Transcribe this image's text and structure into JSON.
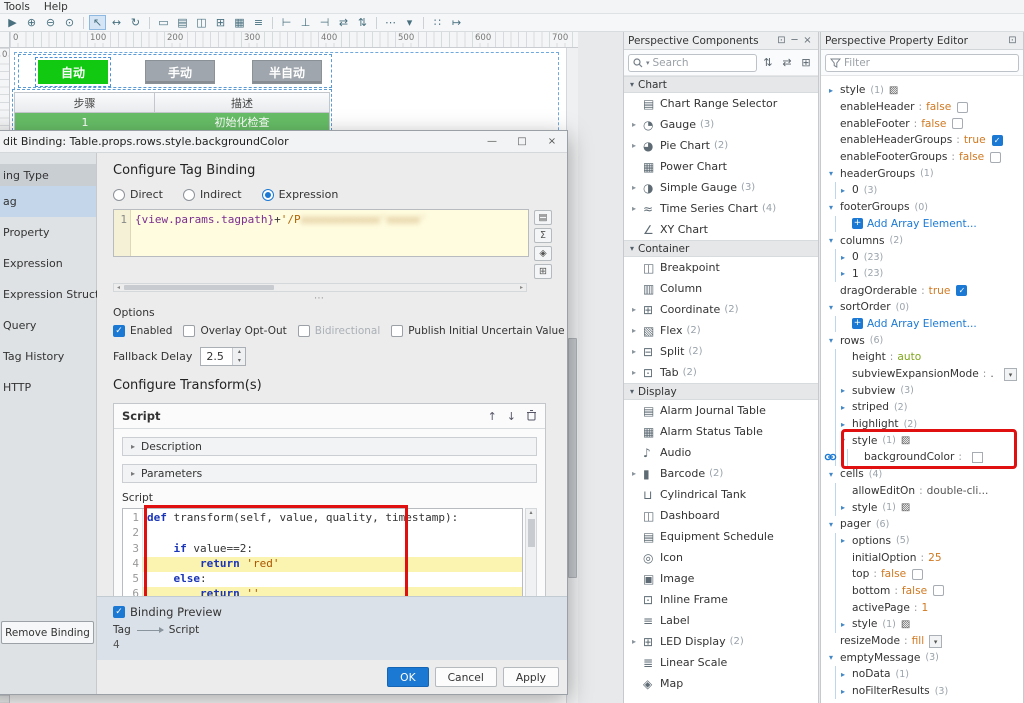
{
  "menubar": {
    "items": [
      {
        "label": "Tools"
      },
      {
        "label": "Help"
      }
    ]
  },
  "toolbar": {
    "icons": [
      {
        "name": "play-icon",
        "glyph": "▶"
      },
      {
        "name": "zoom-in-icon",
        "glyph": "⊕"
      },
      {
        "name": "zoom-out-icon",
        "glyph": "⊖"
      },
      {
        "name": "zoom-actual-icon",
        "glyph": "⊙"
      },
      {
        "sep": true
      },
      {
        "name": "select-tool-icon",
        "glyph": "↖",
        "active": true
      },
      {
        "name": "pan-tool-icon",
        "glyph": "↔"
      },
      {
        "name": "rotate-tool-icon",
        "glyph": "↻"
      },
      {
        "sep": true
      },
      {
        "name": "rectangle-tool-icon",
        "glyph": "▭"
      },
      {
        "name": "browser-preview-icon",
        "glyph": "▤"
      },
      {
        "name": "split-view-icon",
        "glyph": "◫"
      },
      {
        "name": "grid-icon",
        "glyph": "⊞"
      },
      {
        "name": "table-icon",
        "glyph": "▦"
      },
      {
        "name": "text-icon",
        "glyph": "≡"
      },
      {
        "sep": true
      },
      {
        "name": "align-left-icon",
        "glyph": "⊢"
      },
      {
        "name": "align-center-icon",
        "glyph": "⊥"
      },
      {
        "name": "align-right-icon",
        "glyph": "⊣"
      },
      {
        "name": "distribute-horizontal-icon",
        "glyph": "⇄"
      },
      {
        "name": "distribute-vertical-icon",
        "glyph": "⇅"
      },
      {
        "sep": true
      },
      {
        "name": "more-options-icon",
        "glyph": "⋯"
      },
      {
        "name": "dropdown-icon",
        "glyph": "▾"
      },
      {
        "sep": true
      },
      {
        "name": "snap-icon",
        "glyph": "∷"
      },
      {
        "name": "measure-icon",
        "glyph": "↦"
      }
    ]
  },
  "rulers": {
    "horizontal": [
      "0",
      "100",
      "200",
      "300",
      "400",
      "500",
      "600",
      "700"
    ],
    "vertical": [
      "0"
    ]
  },
  "canvas": {
    "buttons": [
      {
        "name": "auto",
        "label": "自动",
        "variant": "green",
        "selected": true
      },
      {
        "name": "manual",
        "label": "手动",
        "variant": "gray",
        "selected": false
      },
      {
        "name": "semi-auto",
        "label": "半自动",
        "variant": "gray",
        "selected": false
      }
    ],
    "table": {
      "headers": [
        "步骤",
        "描述"
      ],
      "rows": [
        [
          "1",
          "初始化检查"
        ]
      ]
    }
  },
  "binding_dialog": {
    "title": "dit Binding: Table.props.rows.style.backgroundColor",
    "sidebar": {
      "header": "ing Type",
      "items": [
        {
          "label": "ag",
          "name": "sidebar-item-tag",
          "selected": true
        },
        {
          "label": "Property",
          "name": "sidebar-item-property",
          "selected": false
        },
        {
          "label": "Expression",
          "name": "sidebar-item-expression",
          "selected": false
        },
        {
          "label": "Expression Structure",
          "name": "sidebar-item-expression-structure",
          "selected": false
        },
        {
          "label": "Query",
          "name": "sidebar-item-query",
          "selected": false
        },
        {
          "label": "Tag History",
          "name": "sidebar-item-tag-history",
          "selected": false
        },
        {
          "label": "HTTP",
          "name": "sidebar-item-http",
          "selected": false
        }
      ],
      "remove_button": "Remove Binding"
    },
    "config": {
      "heading": "Configure Tag Binding",
      "modes": [
        {
          "label": "Direct",
          "selected": false
        },
        {
          "label": "Indirect",
          "selected": false
        },
        {
          "label": "Expression",
          "selected": true
        }
      ],
      "expression": {
        "line": "1",
        "reference": "{view.params.tagpath}",
        "operator": "+",
        "string_start": "'/P",
        "redacted": "xxxxxxxxxxxx'xxxxx'"
      },
      "expression_tools": [
        {
          "name": "browse-tags-icon",
          "glyph": "▤"
        },
        {
          "name": "functions-icon",
          "glyph": "Σ"
        },
        {
          "name": "tag-icon",
          "glyph": "◈"
        },
        {
          "name": "operators-icon",
          "glyph": "⊞"
        }
      ],
      "options_label": "Options",
      "checkboxes": [
        {
          "label": "Enabled",
          "checked": true,
          "disabled": false
        },
        {
          "label": "Overlay Opt-Out",
          "checked": false,
          "disabled": false
        },
        {
          "label": "Bidirectional",
          "checked": false,
          "disabled": true
        },
        {
          "label": "Publish Initial Uncertain Value",
          "checked": false,
          "disabled": false
        }
      ],
      "fallback_delay_label": "Fallback Delay",
      "fallback_delay_value": "2.5"
    },
    "transforms": {
      "heading": "Configure Transform(s)",
      "panel_title": "Script",
      "collapsed_sections": [
        "Description",
        "Parameters"
      ],
      "script_label": "Script",
      "code_lines": [
        "def transform(self, value, quality, timestamp):",
        "",
        "    if value==2:",
        "        return 'red'",
        "    else:",
        "        return ''"
      ],
      "highlighted_lines": [
        4,
        6
      ]
    },
    "preview": {
      "checkbox_label": "Binding Preview",
      "checked": true,
      "source_label": "Tag",
      "source_value": "4",
      "target_label": "Script"
    },
    "buttons": [
      {
        "label": "OK",
        "variant": "primary",
        "name": "ok-button"
      },
      {
        "label": "Cancel",
        "variant": "normal",
        "name": "cancel-button"
      },
      {
        "label": "Apply",
        "variant": "normal",
        "name": "apply-button"
      }
    ]
  },
  "components_panel": {
    "title": "Perspective Components",
    "search_placeholder": "Search",
    "categories": [
      {
        "label": "Chart",
        "items": [
          {
            "label": "Chart Range Selector",
            "glyph": "▤"
          },
          {
            "label": "Gauge",
            "count": "(3)",
            "glyph": "◔",
            "expandable": true
          },
          {
            "label": "Pie Chart",
            "count": "(2)",
            "glyph": "◕",
            "expandable": true
          },
          {
            "label": "Power Chart",
            "glyph": "▦"
          },
          {
            "label": "Simple Gauge",
            "count": "(3)",
            "glyph": "◑",
            "expandable": true
          },
          {
            "label": "Time Series Chart",
            "count": "(4)",
            "glyph": "≈",
            "expandable": true
          },
          {
            "label": "XY Chart",
            "glyph": "∠"
          }
        ]
      },
      {
        "label": "Container",
        "items": [
          {
            "label": "Breakpoint",
            "glyph": "◫"
          },
          {
            "label": "Column",
            "glyph": "▥"
          },
          {
            "label": "Coordinate",
            "count": "(2)",
            "glyph": "⊞",
            "expandable": true
          },
          {
            "label": "Flex",
            "count": "(2)",
            "glyph": "▧",
            "expandable": true
          },
          {
            "label": "Split",
            "count": "(2)",
            "glyph": "⊟",
            "expandable": true
          },
          {
            "label": "Tab",
            "count": "(2)",
            "glyph": "⊡",
            "expandable": true
          }
        ]
      },
      {
        "label": "Display",
        "items": [
          {
            "label": "Alarm Journal Table",
            "glyph": "▤"
          },
          {
            "label": "Alarm Status Table",
            "glyph": "▦"
          },
          {
            "label": "Audio",
            "glyph": "♪"
          },
          {
            "label": "Barcode",
            "count": "(2)",
            "glyph": "▮",
            "expandable": true
          },
          {
            "label": "Cylindrical Tank",
            "glyph": "⊔"
          },
          {
            "label": "Dashboard",
            "glyph": "◫"
          },
          {
            "label": "Equipment Schedule",
            "glyph": "▤"
          },
          {
            "label": "Icon",
            "glyph": "◎"
          },
          {
            "label": "Image",
            "glyph": "▣"
          },
          {
            "label": "Inline Frame",
            "glyph": "⊡"
          },
          {
            "label": "Label",
            "glyph": "≡"
          },
          {
            "label": "LED Display",
            "count": "(2)",
            "glyph": "⊞",
            "expandable": true
          },
          {
            "label": "Linear Scale",
            "glyph": "≣"
          },
          {
            "label": "Map",
            "glyph": "◈"
          }
        ]
      }
    ]
  },
  "property_panel": {
    "title": "Perspective Property Editor",
    "filter_placeholder": "Filter",
    "rows": [
      {
        "arrow": "closed",
        "label": "style",
        "count": "(1)",
        "icons": [
          "style"
        ]
      },
      {
        "label": "enableHeader",
        "value": "false",
        "vclass": "bool",
        "checkbox": "unchecked"
      },
      {
        "label": "enableFooter",
        "value": "false",
        "vclass": "bool",
        "checkbox": "unchecked"
      },
      {
        "label": "enableHeaderGroups",
        "value": "true",
        "vclass": "bool",
        "checkbox": "checked"
      },
      {
        "label": "enableFooterGroups",
        "value": "false",
        "vclass": "bool",
        "checkbox": "unchecked"
      },
      {
        "arrow": "open",
        "label": "headerGroups",
        "count": "(1)"
      },
      {
        "indent": 1,
        "arrow": "closed",
        "label": "0",
        "count": "(3)"
      },
      {
        "arrow": "open",
        "label": "footerGroups",
        "count": "(0)"
      },
      {
        "indent": 1,
        "link": true,
        "label": "Add Array Element..."
      },
      {
        "arrow": "open",
        "label": "columns",
        "count": "(2)"
      },
      {
        "indent": 1,
        "arrow": "closed",
        "label": "0",
        "count": "(23)"
      },
      {
        "indent": 1,
        "arrow": "closed",
        "label": "1",
        "count": "(23)"
      },
      {
        "label": "dragOrderable",
        "value": "true",
        "vclass": "bool",
        "checkbox": "checked"
      },
      {
        "arrow": "open",
        "label": "sortOrder",
        "count": "(0)"
      },
      {
        "indent": 1,
        "link": true,
        "label": "Add Array Element..."
      },
      {
        "arrow": "open",
        "label": "rows",
        "count": "(6)"
      },
      {
        "indent": 1,
        "label": "height",
        "value": "auto",
        "vclass": "str"
      },
      {
        "indent": 1,
        "label": "subviewExpansionMode",
        "value": ".",
        "vclass": "plain",
        "icons": [
          "dropdown"
        ],
        "dropRight": true
      },
      {
        "indent": 1,
        "arrow": "closed",
        "label": "subview",
        "count": "(3)"
      },
      {
        "indent": 1,
        "arrow": "closed",
        "label": "striped",
        "count": "(2)"
      },
      {
        "indent": 1,
        "arrow": "closed",
        "label": "highlight",
        "count": "(2)"
      },
      {
        "indent": 1,
        "arrow": "open",
        "label": "style",
        "count": "(1)",
        "icons": [
          "style"
        ]
      },
      {
        "indent": 2,
        "label": "backgroundColor",
        "value": "",
        "vclass": "plain",
        "icons": [
          "swatch"
        ],
        "bound": true
      },
      {
        "arrow": "open",
        "label": "cells",
        "count": "(4)"
      },
      {
        "indent": 1,
        "label": "allowEditOn",
        "value": "double-cli...",
        "vclass": "plain"
      },
      {
        "indent": 1,
        "arrow": "closed",
        "label": "style",
        "count": "(1)",
        "icons": [
          "style"
        ]
      },
      {
        "arrow": "open",
        "label": "pager",
        "count": "(6)"
      },
      {
        "indent": 1,
        "arrow": "closed",
        "label": "options",
        "count": "(5)"
      },
      {
        "indent": 1,
        "label": "initialOption",
        "value": "25",
        "vclass": "num"
      },
      {
        "indent": 1,
        "label": "top",
        "value": "false",
        "vclass": "bool",
        "checkbox": "unchecked"
      },
      {
        "indent": 1,
        "label": "bottom",
        "value": "false",
        "vclass": "bool",
        "checkbox": "unchecked"
      },
      {
        "indent": 1,
        "label": "activePage",
        "value": "1",
        "vclass": "num"
      },
      {
        "indent": 1,
        "arrow": "closed",
        "label": "style",
        "count": "(1)",
        "icons": [
          "style"
        ]
      },
      {
        "label": "resizeMode",
        "value": "fill",
        "vclass": "enum",
        "icons": [
          "dropdown"
        ]
      },
      {
        "arrow": "open",
        "label": "emptyMessage",
        "count": "(3)"
      },
      {
        "indent": 1,
        "arrow": "closed",
        "label": "noData",
        "count": "(1)"
      },
      {
        "indent": 1,
        "arrow": "closed",
        "label": "noFilterResults",
        "count": "(3)"
      }
    ]
  }
}
